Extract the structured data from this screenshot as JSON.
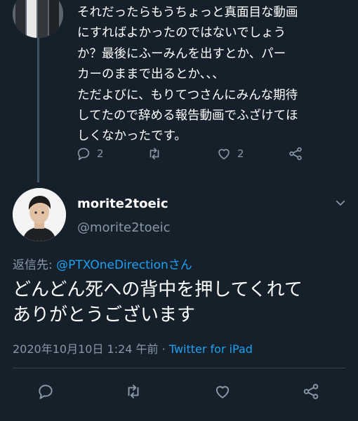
{
  "previous_reply": {
    "lines": [
      "それだったらもうちょっと真面目な動画",
      "にすればよかったのではないでしょう",
      "か？最後にふーみんを出すとか、パー",
      "カーのままで出るとか、、、",
      "ただよびに、もりてつさんにみんな期待",
      "してたので辞める報告動画でふざけてほ",
      "しくなかったです。"
    ],
    "reply_count": "2",
    "like_count": "2"
  },
  "tweet": {
    "display_name": "morite2toeic",
    "handle": "@morite2toeic",
    "replying_label": "返信先: ",
    "replying_mention": "@PTXOneDirectionさん",
    "body_lines": [
      "どんどん死への背中を押してくれて",
      "ありがとうございます"
    ],
    "timestamp": "2020年10月10日 1:24 午前",
    "separator": " · ",
    "source": "Twitter for iPad"
  },
  "icons": {
    "reply": "reply-icon",
    "retweet": "retweet-icon",
    "like": "heart-icon",
    "share": "share-icon",
    "menu": "chevron-down-icon"
  },
  "colors": {
    "background": "#15202b",
    "text": "#ffffff",
    "secondary": "#8899a6",
    "accent": "#1da1f2"
  }
}
